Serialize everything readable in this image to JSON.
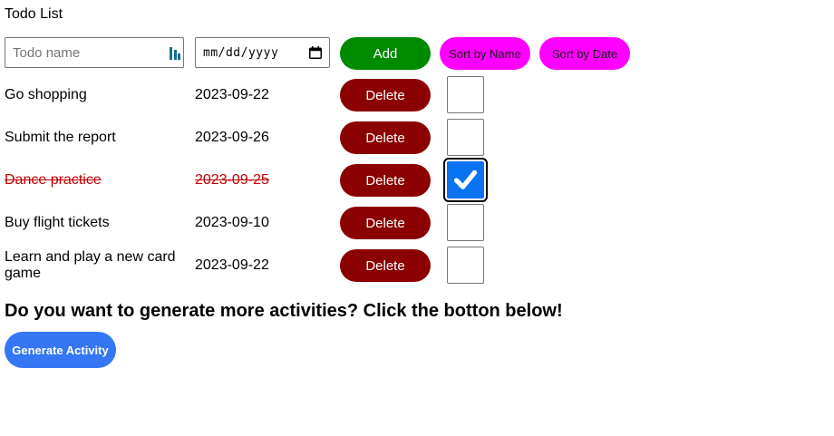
{
  "app": {
    "title": "Todo List"
  },
  "form": {
    "name_placeholder": "Todo name",
    "date_placeholder": "mm/dd/yyyy",
    "add_label": "Add",
    "sort_name_label": "Sort by Name",
    "sort_date_label": "Sort by Date"
  },
  "todos": [
    {
      "name": "Go shopping",
      "date": "2023-09-22",
      "delete_label": "Delete",
      "done": false
    },
    {
      "name": "Submit the report",
      "date": "2023-09-26",
      "delete_label": "Delete",
      "done": false
    },
    {
      "name": "Dance practice",
      "date": "2023-09-25",
      "delete_label": "Delete",
      "done": true
    },
    {
      "name": "Buy flight tickets",
      "date": "2023-09-10",
      "delete_label": "Delete",
      "done": false
    },
    {
      "name": "Learn and play a new card game",
      "date": "2023-09-22",
      "delete_label": "Delete",
      "done": false
    }
  ],
  "generate": {
    "prompt": "Do you want to generate more activities? Click the botton below!",
    "button_label": "Generate Activity"
  },
  "colors": {
    "add": "#008a00",
    "sort": "#ff00ff",
    "delete": "#8b0000",
    "checked": "#0a74f0",
    "done_text": "#c00000",
    "generate": "#3576f5"
  },
  "icons": {
    "password_manager": "password-manager-icon",
    "calendar": "calendar-icon",
    "check": "checkmark-icon"
  }
}
